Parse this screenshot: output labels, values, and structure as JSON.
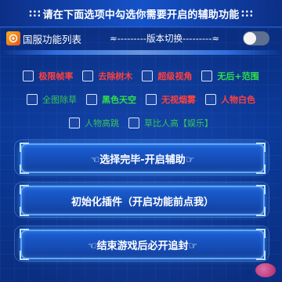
{
  "header": {
    "title": "请在下面选项中勾选你需要开启的辅助功能"
  },
  "top_row": {
    "game_icon": "game-icon",
    "list_label": "国服功能列表",
    "switch_label": "≈---------版本切换---------≈",
    "toggle_on": false
  },
  "options": {
    "row1": [
      {
        "label": "极限帧率",
        "color": "red"
      },
      {
        "label": "去除树木",
        "color": "red"
      },
      {
        "label": "超级视角",
        "color": "red"
      },
      {
        "label": "无后+范围",
        "color": "green"
      }
    ],
    "row2": [
      {
        "label": "全图除草",
        "color": "dimgreen"
      },
      {
        "label": "黑色天空",
        "color": "green"
      },
      {
        "label": "无视烟雾",
        "color": "red"
      },
      {
        "label": "人物白色",
        "color": "red"
      }
    ],
    "row3": [
      {
        "label": "人物高跳",
        "color": "dimgreen"
      },
      {
        "label": "草比人高【娱乐】",
        "color": "dimgreen"
      }
    ]
  },
  "buttons": {
    "confirm": "☜选择完毕-开启辅助☞",
    "init": "初始化插件（开启功能前点我）",
    "end": "☜结束游戏后必开追封☞"
  }
}
